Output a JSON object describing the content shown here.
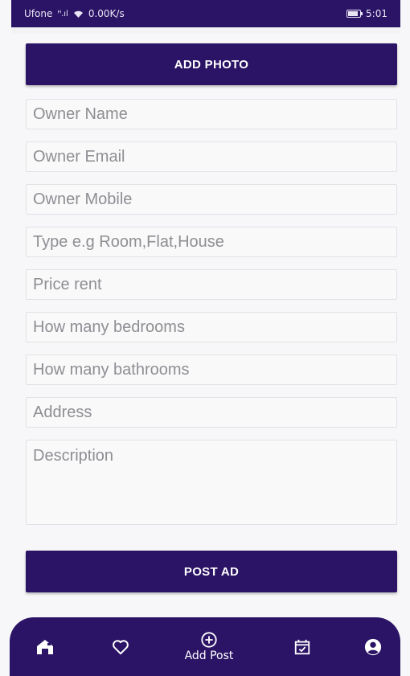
{
  "status_bar": {
    "carrier": "Ufone",
    "signal": "ᴴ.ıl",
    "net_speed": "0.00K/s",
    "time": "5:01",
    "battery_level_percent": 85
  },
  "form": {
    "add_photo_label": "ADD PHOTO",
    "fields": [
      {
        "name": "owner-name",
        "placeholder": "Owner Name",
        "value": ""
      },
      {
        "name": "owner-email",
        "placeholder": "Owner Email",
        "value": ""
      },
      {
        "name": "owner-mobile",
        "placeholder": "Owner Mobile",
        "value": ""
      },
      {
        "name": "property-type",
        "placeholder": "Type e.g Room,Flat,House",
        "value": ""
      },
      {
        "name": "price-rent",
        "placeholder": "Price rent",
        "value": ""
      },
      {
        "name": "bedrooms",
        "placeholder": "How many bedrooms",
        "value": ""
      },
      {
        "name": "bathrooms",
        "placeholder": "How many bathrooms",
        "value": ""
      },
      {
        "name": "address",
        "placeholder": "Address",
        "value": ""
      }
    ],
    "description": {
      "placeholder": "Description",
      "value": ""
    },
    "post_ad_label": "POST AD"
  },
  "bottom_nav": {
    "items": [
      {
        "icon": "home-icon",
        "label": ""
      },
      {
        "icon": "heart-icon",
        "label": ""
      },
      {
        "icon": "add-circle-icon",
        "label": "Add Post"
      },
      {
        "icon": "calendar-check-icon",
        "label": ""
      },
      {
        "icon": "account-icon",
        "label": ""
      }
    ]
  },
  "colors": {
    "primary": "#2b1466",
    "background": "#f7f7f9",
    "field_border": "#e2e2e6",
    "placeholder": "#8e8e93"
  }
}
